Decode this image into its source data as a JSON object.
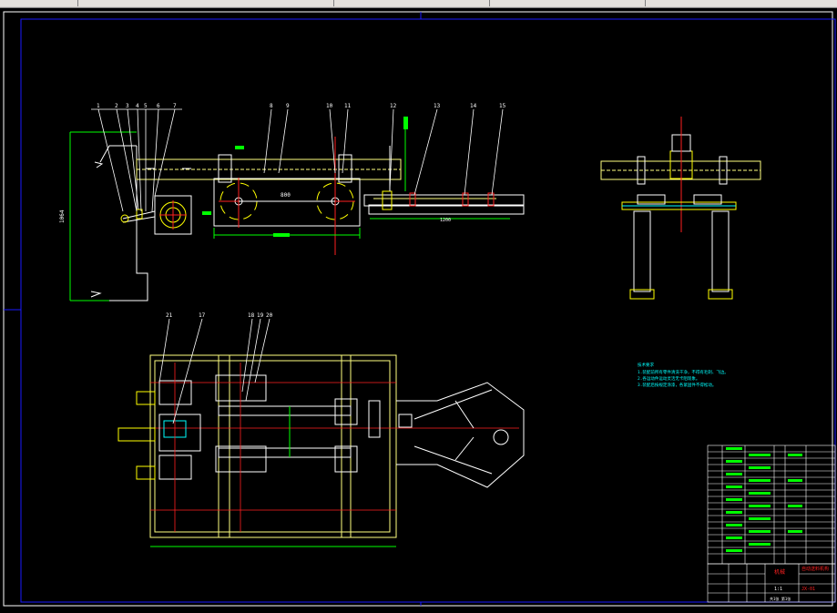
{
  "toolbar": {
    "segments": [
      "",
      "",
      "",
      "",
      ""
    ]
  },
  "drawing": {
    "part_callouts_top": [
      "1",
      "2",
      "3",
      "4",
      "5",
      "6",
      "7",
      "8",
      "9",
      "10",
      "11",
      "12",
      "13",
      "14",
      "15"
    ],
    "part_callouts_bottom": [
      "21",
      "17",
      "18",
      "19",
      "20"
    ],
    "dim_center": "800",
    "dim_lower": "1200",
    "dim_vertical": "1064",
    "tech_notes_title": "技术要求",
    "tech_notes": [
      "1.装配前所有零件清洗干净，不得有毛刺、飞边。",
      "2.各运动件运动灵活无卡阻现象。",
      "3.装配后按规定涂漆，各紧固件不得松动。"
    ],
    "title_block": {
      "company": "机械",
      "drawing_name": "自动送料机构",
      "drawing_no": "JX-01",
      "sheet": "共1张 第1张",
      "scale": "1:1"
    }
  },
  "colors": {
    "background": "#000000",
    "frame": "#ffffff",
    "outline": "#ffff80",
    "center": "#ff2020",
    "dimension": "#00ff00",
    "text": "#ffffff",
    "leader": "#ffffff",
    "hatch": "#ffff00",
    "accent": "#00ffff"
  }
}
